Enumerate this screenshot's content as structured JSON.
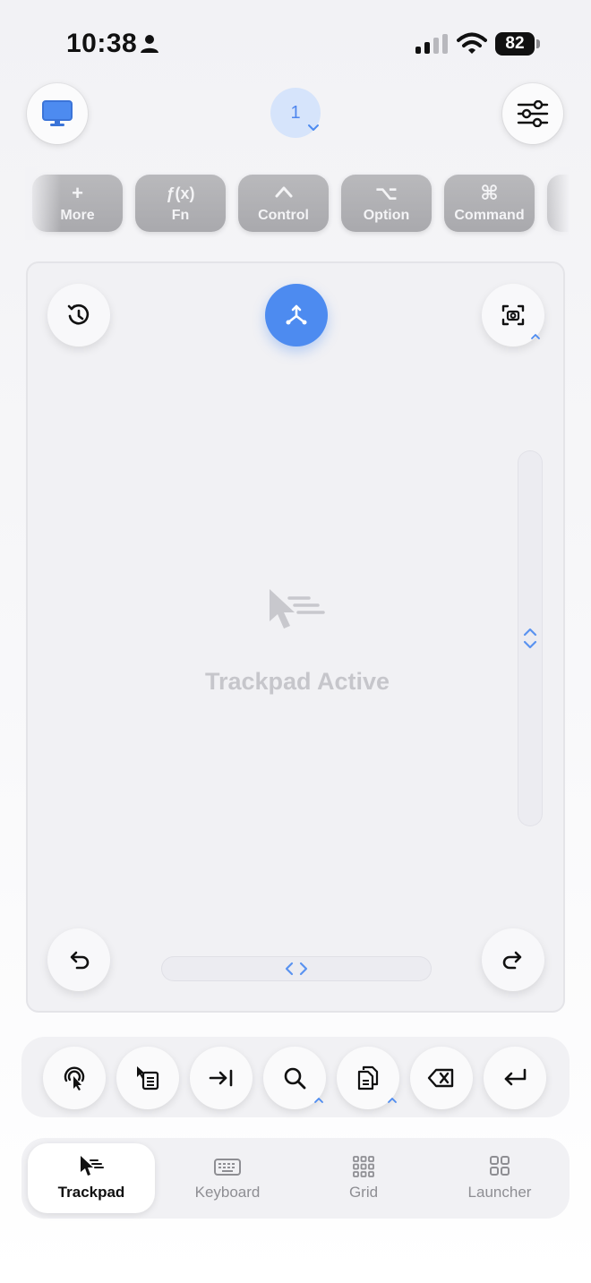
{
  "status_bar": {
    "time": "10:38",
    "battery_level": "82"
  },
  "header": {
    "screen_number": "1",
    "icons": [
      "monitor-icon",
      "sliders-icon"
    ]
  },
  "modifiers": [
    {
      "symbol": "+",
      "label": "More"
    },
    {
      "symbol": "ƒ(x)",
      "label": "Fn"
    },
    {
      "symbol": "^",
      "label": "Control"
    },
    {
      "symbol": "⌥",
      "label": "Option"
    },
    {
      "symbol": "⌘",
      "label": "Command"
    }
  ],
  "trackpad": {
    "status_text": "Trackpad Active"
  },
  "actions": [
    "force-click-icon",
    "select-text-icon",
    "tab-key-icon",
    "search-icon",
    "copy-icon",
    "delete-icon",
    "return-icon"
  ],
  "tabs": [
    {
      "label": "Trackpad",
      "icon": "cursor-icon",
      "active": true
    },
    {
      "label": "Keyboard",
      "icon": "keyboard-icon",
      "active": false
    },
    {
      "label": "Grid",
      "icon": "grid-icon",
      "active": false
    },
    {
      "label": "Launcher",
      "icon": "launcher-icon",
      "active": false
    }
  ],
  "colors": {
    "accent": "#4d8bf0",
    "modifier_key": "#ababaf",
    "inactive_text": "#8e8e93"
  }
}
